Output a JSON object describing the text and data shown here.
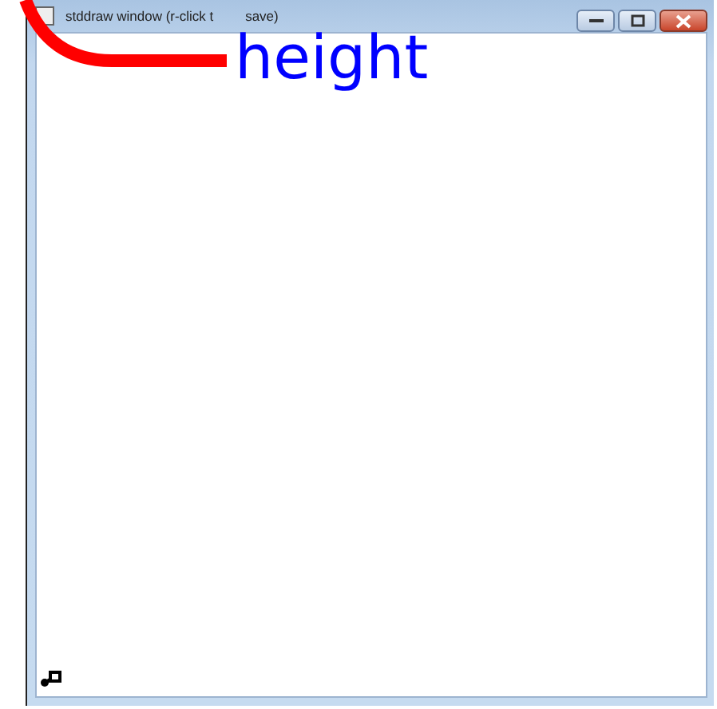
{
  "window": {
    "title_start": "stddraw window (r-click t",
    "title_end": "save)"
  },
  "annotation": {
    "label": "height"
  }
}
